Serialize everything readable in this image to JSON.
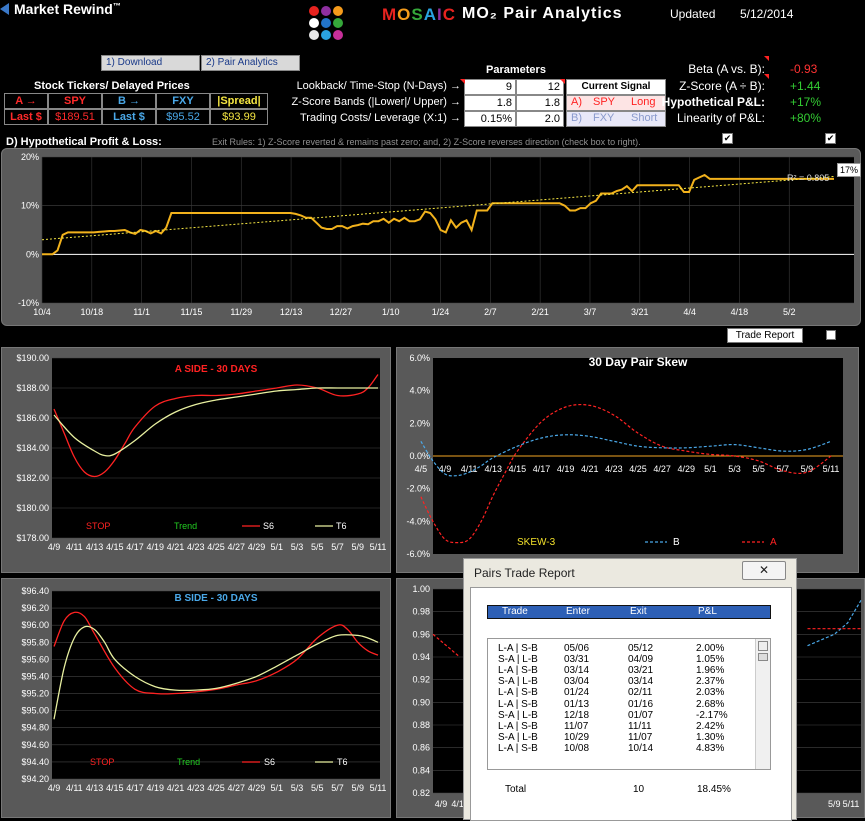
{
  "app": {
    "brand": "Market Rewind",
    "trademark": "™",
    "logo_text": "MOSAIC",
    "subtitle": "MO₂ Pair Analytics",
    "updated_label": "Updated",
    "updated_date": "5/12/2014",
    "logo_dot_colors": [
      "#e8231f",
      "#8e2fa0",
      "#f59b1b",
      "#ffffff",
      "#2273c8",
      "#35a83a",
      "#e8e8e8",
      "#2aa3e0",
      "#c62f9a"
    ]
  },
  "tabs": {
    "download": "1) Download",
    "pair_analytics": "2) Pair Analytics"
  },
  "tickers": {
    "header": "Stock Tickers/ Delayed Prices",
    "a_label": "A →",
    "a_symbol": "SPY",
    "b_label": "B →",
    "b_symbol": "FXY",
    "spread_label": "|Spread|",
    "last_label_a": "Last $",
    "last_price_a": "$189.51",
    "last_label_b": "Last $",
    "last_price_b": "$95.52",
    "spread_value": "$93.99"
  },
  "parameters": {
    "header": "Parameters",
    "rows": [
      {
        "label": "Lookback/ Time-Stop (N-Days) →",
        "v1": "9",
        "v2": "12"
      },
      {
        "label": "Z-Score Bands (|Lower|/ Upper) →",
        "v1": "1.8",
        "v2": "1.8"
      },
      {
        "label": "Trading Costs/ Leverage (X:1) →",
        "v1": "0.15%",
        "v2": "2.0"
      }
    ],
    "signal_header": "Current Signal",
    "signal_a_letter": "A)",
    "signal_a_symbol": "SPY",
    "signal_a_dir": "Long",
    "signal_b_letter": "B)",
    "signal_b_symbol": "FXY",
    "signal_b_dir": "Short"
  },
  "stats": [
    {
      "label": "Beta (A vs. B):",
      "value": "-0.93",
      "color": "#ff3333"
    },
    {
      "label": "Z-Score (A ÷ B):",
      "value": "+1.44",
      "color": "#33cc33"
    },
    {
      "label": "Hypothetical P&L:",
      "value": "+17%",
      "color": "#33cc33"
    },
    {
      "label": "Linearity of P&L:",
      "value": "+80%",
      "color": "#33cc33"
    }
  ],
  "pnl_section": {
    "title": "D) Hypothetical Profit & Loss:",
    "exit_rules": "Exit Rules:  1) Z-Score reverted & remains past zero; and, 2) Z-Score reverses direction (check box to right).",
    "check_1": "✔",
    "check_2": "✔",
    "trade_report_button": "Trade Report",
    "end_label": "17%",
    "r2_label": "R² = 0.805"
  },
  "chart_data": [
    {
      "type": "line",
      "id": "pnl",
      "y_tick_labels": [
        "20%",
        "10%",
        "0%",
        "-10%"
      ],
      "x_tick_labels": [
        "10/4",
        "10/18",
        "11/1",
        "11/15",
        "11/29",
        "12/13",
        "12/27",
        "1/10",
        "1/24",
        "2/7",
        "2/21",
        "3/7",
        "3/21",
        "4/4",
        "4/18",
        "5/2"
      ],
      "ylim": [
        -10,
        20
      ],
      "series": [
        {
          "color": "#f2b21c",
          "values": [
            0,
            0,
            0,
            0.8,
            4,
            4.5,
            4.5,
            4.5,
            4.5,
            4.5,
            4.5,
            4.6,
            4.7,
            4.8,
            4.8,
            4.9,
            5,
            4.5,
            4.2,
            5,
            4.8,
            4.3,
            4.8,
            4.3,
            5.5,
            8.5,
            8.5,
            8.5,
            8.5,
            8.5,
            8.5,
            8.5,
            8.5,
            8.5,
            8.5,
            8.5,
            8.5,
            8.5,
            8.5,
            8.5,
            8.5,
            8.5,
            8.5,
            8.5,
            8.5,
            8.5,
            8.5,
            8.5,
            8.5,
            8.3,
            8,
            7.5,
            7.5,
            6.5,
            5.5,
            5.2,
            5.2,
            5.8,
            5.8,
            5.3,
            5.8,
            6,
            6.3,
            6.2,
            6.8,
            6.8,
            7.3,
            6.5,
            7.3,
            6.8,
            7.5,
            6.8,
            6.8,
            7.2,
            8.8,
            8.5,
            7.2,
            5,
            4.5,
            7,
            5.5,
            6.5,
            7,
            5,
            9,
            9,
            9,
            10.5,
            10.5,
            10.5,
            10.5,
            10.5,
            10.5,
            10.5,
            10.5,
            10.5,
            10.5,
            10.5,
            10.5,
            10.5,
            10.5,
            10,
            9,
            9,
            9.5,
            9.5,
            10.5,
            11,
            12.5,
            12.5,
            12.5,
            13,
            13.3,
            14,
            13,
            14.2,
            14.2,
            14.2,
            14.2,
            14.2,
            14.2,
            14.2,
            14.2,
            14.2,
            12.8,
            12.8,
            15.3,
            15.8,
            16.3,
            15.5,
            15.5,
            15.5,
            15.5,
            15.5,
            15.5,
            15.5,
            15.5,
            15.5,
            15.5,
            15.5,
            15.5,
            15.5,
            15.5,
            15.5,
            15.5,
            15.5,
            15.5,
            15.5,
            15.5,
            15.5,
            15.5,
            15.5,
            15.5,
            15.5
          ]
        },
        {
          "color": "#f5e642",
          "style": "dotted",
          "values": [
            3,
            16
          ]
        }
      ]
    },
    {
      "type": "line",
      "id": "a_side",
      "title": "A  SIDE - 30 DAYS",
      "y_tick_labels": [
        "$190.00",
        "$188.00",
        "$186.00",
        "$184.00",
        "$182.00",
        "$180.00",
        "$178.00"
      ],
      "ylim": [
        178,
        190
      ],
      "x_tick_labels": [
        "4/9",
        "4/11",
        "4/13",
        "4/15",
        "4/17",
        "4/19",
        "4/21",
        "4/23",
        "4/25",
        "4/27",
        "4/29",
        "5/1",
        "5/3",
        "5/5",
        "5/7",
        "5/9",
        "5/11"
      ],
      "legend": [
        {
          "name": "STOP",
          "color": "#ff2222"
        },
        {
          "name": "Trend",
          "color": "#22cc22"
        },
        {
          "name": "S6",
          "color": "#ff2222"
        },
        {
          "name": "T6",
          "color": "#e8f0a0"
        }
      ],
      "series": [
        {
          "name": "S6",
          "color": "#ff2222",
          "x": [
            0,
            0.5,
            1,
            1.5,
            2,
            2.5,
            3,
            3.5,
            4,
            5,
            6,
            7,
            8,
            9,
            10,
            11,
            12,
            13,
            14,
            15,
            15.5,
            16
          ],
          "y": [
            186.6,
            185,
            183.4,
            182.4,
            182.1,
            182.4,
            183.2,
            184.3,
            185.4,
            186.8,
            187.3,
            187.5,
            187.5,
            187.6,
            187.8,
            188,
            188.2,
            188,
            187.5,
            187.6,
            188,
            188.9
          ]
        },
        {
          "name": "T6",
          "color": "#e8f0a0",
          "x": [
            0,
            1,
            2,
            2.5,
            3,
            4,
            5,
            6,
            7,
            8,
            9,
            10,
            11,
            12,
            13,
            14,
            15,
            15.5,
            16
          ],
          "y": [
            186.2,
            184.7,
            183.8,
            183.5,
            183.6,
            184.5,
            185.6,
            186.4,
            186.9,
            187.2,
            187.4,
            187.6,
            187.8,
            187.9,
            188,
            188,
            188,
            188,
            188
          ]
        }
      ]
    },
    {
      "type": "line",
      "id": "skew",
      "title": "30 Day  Pair  Skew",
      "y_tick_labels": [
        "6.0%",
        "4.0%",
        "2.0%",
        "0.0%",
        "-2.0%",
        "-4.0%",
        "-6.0%"
      ],
      "ylim": [
        -6,
        6
      ],
      "x_tick_labels": [
        "4/9",
        "4/11",
        "4/13",
        "4/15",
        "4/17",
        "4/19",
        "4/21",
        "4/23",
        "4/25",
        "4/27",
        "4/29",
        "5/1",
        "5/3",
        "5/5",
        "5/7",
        "5/9",
        "5/11"
      ],
      "x_start_label": "4/5",
      "legend": [
        {
          "name": "SKEW-3",
          "color": "#f2e02a"
        },
        {
          "name": "B",
          "color": "#4aa8e8"
        },
        {
          "name": "A",
          "color": "#ff2222"
        }
      ],
      "series": [
        {
          "name": "A",
          "color": "#ff2222",
          "style": "dashed",
          "x": [
            -1,
            -0.5,
            0,
            0.5,
            1,
            1.5,
            2,
            2.5,
            3,
            4,
            5,
            6,
            7,
            8,
            9,
            10,
            11,
            12,
            13,
            14,
            15,
            16
          ],
          "y": [
            -2.5,
            -4,
            -5.1,
            -5.3,
            -5.1,
            -4,
            -2.4,
            -1,
            0.3,
            2.1,
            3,
            3.1,
            2.5,
            1.4,
            0.6,
            0.3,
            0.1,
            0,
            -0.3,
            -0.9,
            -1,
            0
          ]
        },
        {
          "name": "B",
          "color": "#4aa8e8",
          "style": "dashed",
          "x": [
            -1,
            -0.5,
            0,
            0.5,
            1,
            1.5,
            2,
            3,
            4,
            5,
            6,
            7,
            8,
            9,
            10,
            11,
            12,
            13,
            14,
            15,
            16
          ],
          "y": [
            0.9,
            -0.3,
            -1.1,
            -1.2,
            -1,
            -0.6,
            -0.1,
            0.6,
            1.1,
            1.3,
            1.2,
            0.9,
            0.6,
            0.5,
            0.5,
            0.6,
            0.7,
            0.5,
            0.3,
            0.4,
            0.9
          ]
        },
        {
          "name": "SKEW-3",
          "color": "#f2e02a",
          "values": [
            0,
            0
          ]
        }
      ]
    },
    {
      "type": "line",
      "id": "b_side",
      "title": "B  SIDE - 30 DAYS",
      "y_tick_labels": [
        "$96.40",
        "$96.20",
        "$96.00",
        "$95.80",
        "$95.60",
        "$95.40",
        "$95.20",
        "$95.00",
        "$94.80",
        "$94.60",
        "$94.40",
        "$94.20"
      ],
      "ylim": [
        94.2,
        96.4
      ],
      "x_tick_labels": [
        "4/9",
        "4/11",
        "4/13",
        "4/15",
        "4/17",
        "4/19",
        "4/21",
        "4/23",
        "4/25",
        "4/27",
        "4/29",
        "5/1",
        "5/3",
        "5/5",
        "5/7",
        "5/9",
        "5/11"
      ],
      "legend": [
        {
          "name": "STOP",
          "color": "#ff2222"
        },
        {
          "name": "Trend",
          "color": "#22cc22"
        },
        {
          "name": "S6",
          "color": "#ff2222"
        },
        {
          "name": "T6",
          "color": "#e8f0a0"
        }
      ],
      "series": [
        {
          "name": "S6",
          "color": "#ff2222",
          "x": [
            0,
            0.5,
            1,
            1.5,
            2,
            3,
            4,
            5,
            6,
            7,
            8,
            9,
            10,
            11,
            12,
            13,
            14,
            14.5,
            15,
            15.5,
            16
          ],
          "y": [
            95.75,
            96.05,
            96.15,
            96.1,
            95.9,
            95.5,
            95.25,
            95.2,
            95.2,
            95.22,
            95.25,
            95.3,
            95.35,
            95.45,
            95.6,
            95.85,
            96,
            95.95,
            95.8,
            95.7,
            95.65
          ]
        },
        {
          "name": "T6",
          "color": "#e8f0a0",
          "x": [
            0,
            0.5,
            1,
            1.5,
            2,
            2.5,
            3,
            4,
            5,
            6,
            7,
            8,
            9,
            10,
            11,
            12,
            13,
            14,
            15,
            15.5,
            16
          ],
          "y": [
            94.9,
            95.5,
            95.85,
            95.98,
            95.95,
            95.8,
            95.6,
            95.4,
            95.28,
            95.24,
            95.24,
            95.26,
            95.32,
            95.4,
            95.52,
            95.65,
            95.78,
            95.88,
            95.88,
            95.85,
            95.8
          ]
        }
      ]
    },
    {
      "type": "line",
      "id": "corr",
      "y_tick_labels": [
        "1.00",
        "0.98",
        "0.96",
        "0.94",
        "0.92",
        "0.90",
        "0.88",
        "0.86",
        "0.84",
        "0.82"
      ],
      "ylim": [
        0.82,
        1.0
      ],
      "x_tick_labels": [
        "4/9",
        "4/11",
        "5/9",
        "5/11"
      ],
      "series": [
        {
          "color": "#ff2222",
          "style": "dashed",
          "x": [
            0,
            1
          ],
          "y": [
            0.96,
            0.94
          ]
        },
        {
          "color": "#4aa8e8",
          "style": "dashed",
          "x": [
            14,
            15,
            15.5,
            16
          ],
          "y": [
            0.95,
            0.96,
            0.97,
            0.99
          ]
        },
        {
          "color": "#ff2222",
          "style": "dashed",
          "x": [
            14,
            16
          ],
          "y": [
            0.965,
            0.965
          ]
        }
      ]
    }
  ],
  "trade_report": {
    "title": "Pairs Trade Report",
    "close_glyph": "✕",
    "columns": [
      "Trade",
      "Enter",
      "Exit",
      "P&L"
    ],
    "rows": [
      [
        "L-A | S-B",
        "05/06",
        "05/12",
        "2.00%"
      ],
      [
        "S-A | L-B",
        "03/31",
        "04/09",
        "1.05%"
      ],
      [
        "L-A | S-B",
        "03/14",
        "03/21",
        "1.96%"
      ],
      [
        "S-A | L-B",
        "03/04",
        "03/14",
        "2.37%"
      ],
      [
        "L-A | S-B",
        "01/24",
        "02/11",
        "2.03%"
      ],
      [
        "L-A | S-B",
        "01/13",
        "01/16",
        "2.68%"
      ],
      [
        "S-A | L-B",
        "12/18",
        "01/07",
        "-2.17%"
      ],
      [
        "L-A | S-B",
        "11/07",
        "11/11",
        "2.42%"
      ],
      [
        "S-A | L-B",
        "10/29",
        "11/07",
        "1.30%"
      ],
      [
        "L-A | S-B",
        "10/08",
        "10/14",
        "4.83%"
      ]
    ],
    "total_label": "Total",
    "total_count": "10",
    "total_pnl": "18.45%"
  }
}
